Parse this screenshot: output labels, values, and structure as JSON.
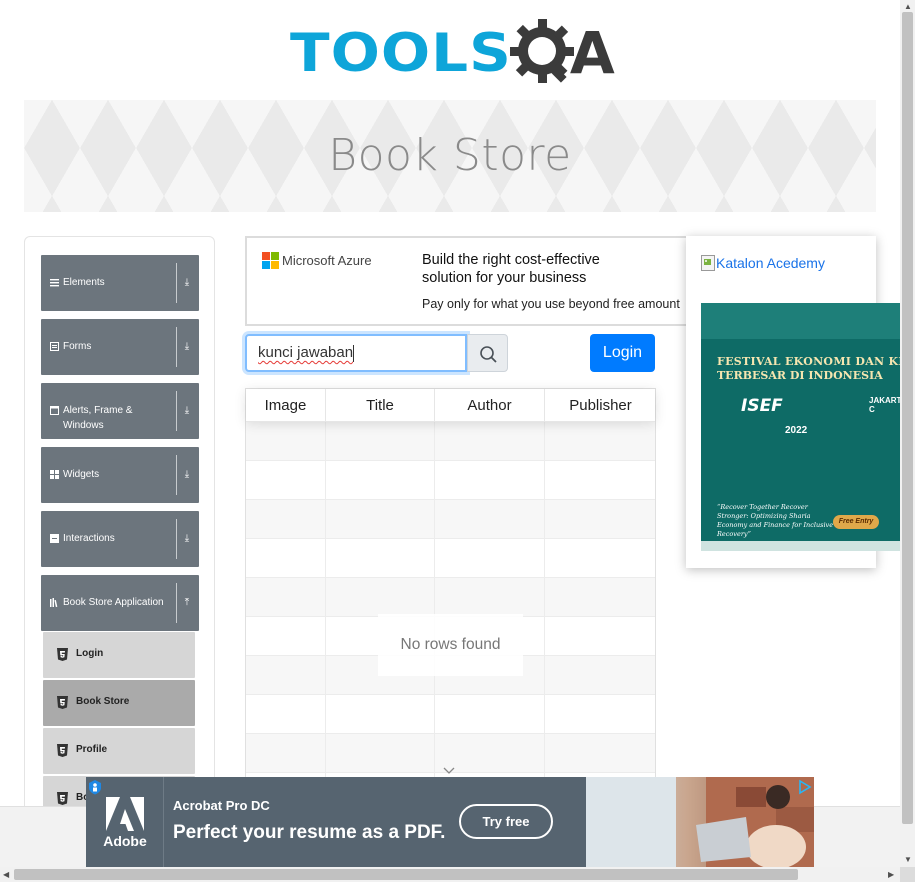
{
  "header": {
    "logo_text": "TOOLS",
    "logo_suffix": "A"
  },
  "banner": {
    "title": "Book Store"
  },
  "sidebar": {
    "groups": [
      {
        "label": "Elements",
        "icon": "hamburger-icon",
        "arrow": "⤓"
      },
      {
        "label": "Forms",
        "icon": "list-icon",
        "arrow": "⤓"
      },
      {
        "label": "Alerts, Frame & Windows",
        "icon": "window-icon",
        "arrow": "⤓"
      },
      {
        "label": "Widgets",
        "icon": "grid-icon",
        "arrow": "⤓"
      },
      {
        "label": "Interactions",
        "icon": "square-icon",
        "arrow": "⤓"
      },
      {
        "label": "Book Store Application",
        "icon": "books-icon",
        "arrow": "⤒"
      }
    ],
    "sub_items": [
      {
        "label": "Login",
        "active": false
      },
      {
        "label": "Book Store",
        "active": true
      },
      {
        "label": "Profile",
        "active": false
      },
      {
        "label": "Bo",
        "active": false
      }
    ]
  },
  "ad_top": {
    "brand": "Microsoft Azure",
    "headline": "Build the right cost-effective solution for your business",
    "subline": "Pay only for what you use beyond free amount"
  },
  "search": {
    "value": "kunci jawaban",
    "button_icon": "search-icon"
  },
  "login_button": "Login",
  "table": {
    "columns": [
      "Image",
      "Title",
      "Author",
      "Publisher"
    ],
    "empty_message": "No rows found"
  },
  "ad_right": {
    "link_text": "Katalon Acedemy",
    "poster_line1": "FESTIVAL EKONOMI DAN KEUAN",
    "poster_line2": "TERBESAR DI INDONESIA",
    "poster_event": "ISEF",
    "poster_year": "2022",
    "poster_city": "JAKARTA C",
    "poster_quote": "“Recover Together Recover Stronger: Optimizing Sharia Economy and Finance for Inclusive Recovery”",
    "poster_cta": "Free Entry"
  },
  "ad_bottom": {
    "brand": "Adobe",
    "product": "Acrobat Pro DC",
    "tagline": "Perfect your resume as a PDF.",
    "cta": "Try free"
  },
  "colors": {
    "logo_blue": "#0ea5d9",
    "sidebar_group": "#6c757d",
    "primary": "#007bff",
    "adobe_bg": "#566470"
  }
}
